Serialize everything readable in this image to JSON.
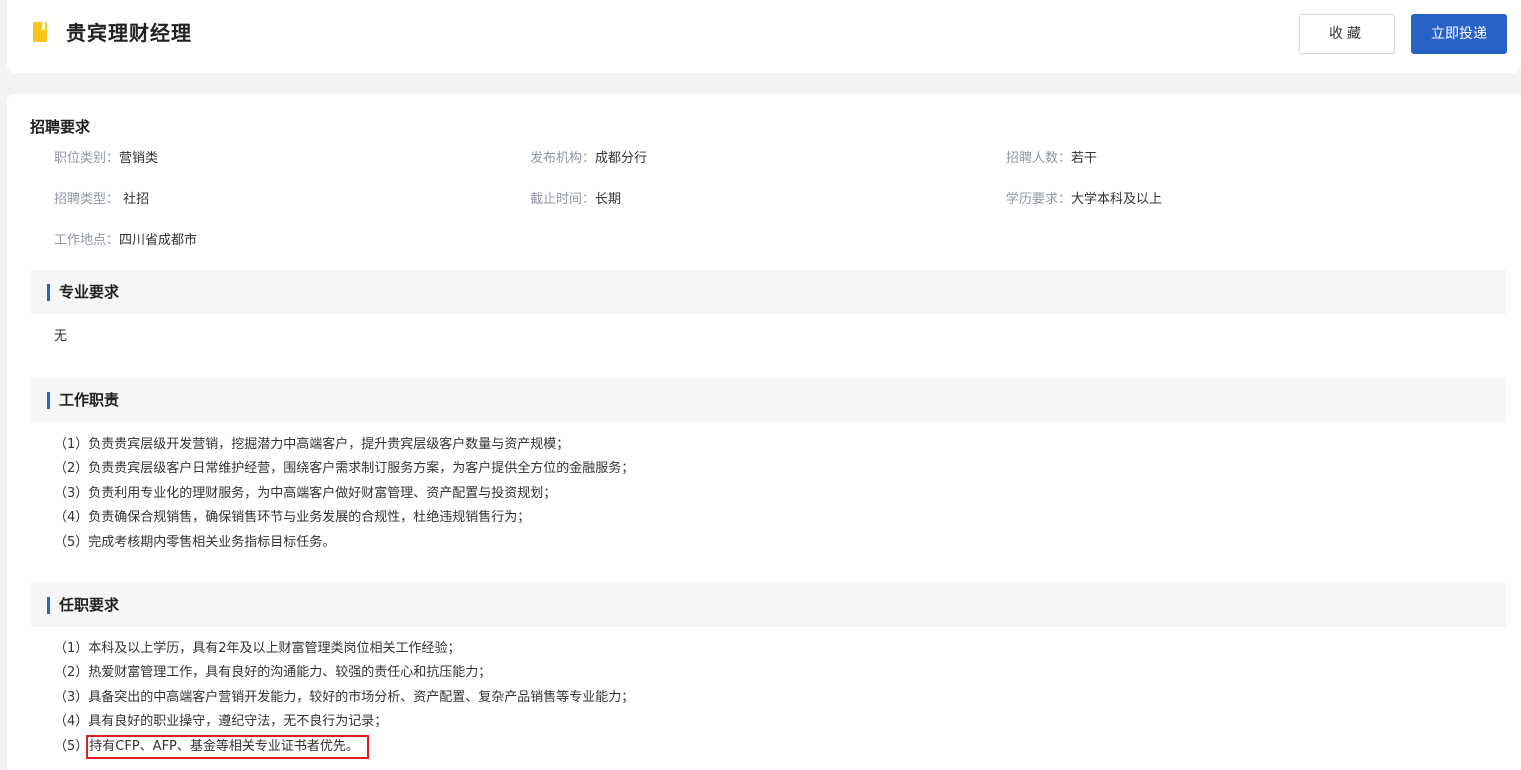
{
  "header": {
    "title": "贵宾理财经理",
    "collect_label": "收藏",
    "apply_label": "立即投递",
    "icon": "bookmark-icon",
    "icon_color": "#f5c518"
  },
  "requirements": {
    "title": "招聘要求",
    "fields": [
      {
        "label": "职位类别：",
        "value": "营销类"
      },
      {
        "label": "发布机构：",
        "value": "成都分行"
      },
      {
        "label": "招聘人数：",
        "value": "若干"
      },
      {
        "label": "招聘类型：",
        "value": " 社招"
      },
      {
        "label": "截止时间：",
        "value": "长期"
      },
      {
        "label": "学历要求：",
        "value": "大学本科及以上"
      },
      {
        "label": "工作地点：",
        "value": "四川省成都市"
      }
    ]
  },
  "professional": {
    "title": "专业要求",
    "text": "无"
  },
  "duties": {
    "title": "工作职责",
    "items": [
      "（1）负责贵宾层级开发营销，挖掘潜力中高端客户，提升贵宾层级客户数量与资产规模；",
      "（2）负责贵宾层级客户日常维护经营，围绕客户需求制订服务方案，为客户提供全方位的金融服务；",
      "（3）负责利用专业化的理财服务，为中高端客户做好财富管理、资产配置与投资规划；",
      "（4）负责确保合规销售，确保销售环节与业务发展的合规性，杜绝违规销售行为；",
      "（5）完成考核期内零售相关业务指标目标任务。"
    ]
  },
  "qualifications": {
    "title": "任职要求",
    "items": [
      "（1）本科及以上学历，具有2年及以上财富管理类岗位相关工作经验；",
      "（2）热爱财富管理工作，具有良好的沟通能力、较强的责任心和抗压能力；",
      "（3）具备突出的中高端客户营销开发能力，较好的市场分析、资产配置、复杂产品销售等专业能力；",
      "（4）具有良好的职业操守，遵纪守法，无不良行为记录；"
    ],
    "last_prefix": "（5）",
    "last_text": "持有CFP、AFP、基金等相关专业证书者优先。"
  },
  "colors": {
    "accent": "#2862c6",
    "highlight_box": "#e02020",
    "label_gray": "#9097a3"
  }
}
